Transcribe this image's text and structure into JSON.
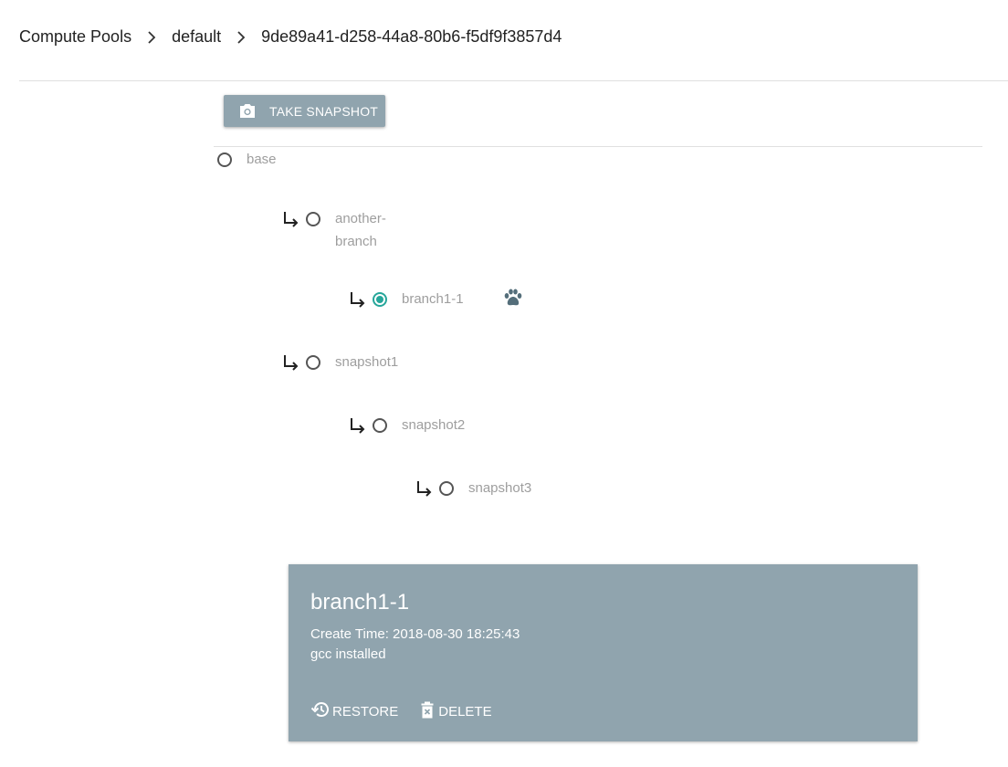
{
  "breadcrumb": {
    "items": [
      "Compute Pools",
      "default",
      "9de89a41-d258-44a8-80b6-f5df9f3857d4"
    ]
  },
  "toolbar": {
    "take_snapshot_label": "TAKE SNAPSHOT",
    "take_snapshot_icon": "camera-icon"
  },
  "tree": {
    "nodes": [
      {
        "label": "base",
        "selected": false
      },
      {
        "label_line1": "another-",
        "label_line2": "branch",
        "selected": false
      },
      {
        "label": "branch1-1",
        "selected": true,
        "badge_icon": "paw-icon"
      },
      {
        "label": "snapshot1",
        "selected": false
      },
      {
        "label": "snapshot2",
        "selected": false
      },
      {
        "label": "snapshot3",
        "selected": false
      }
    ]
  },
  "detail": {
    "title": "branch1-1",
    "create_time": "Create Time: 2018-08-30 18:25:43",
    "description": "gcc installed",
    "restore_label": "RESTORE",
    "delete_label": "DELETE"
  },
  "colors": {
    "accent": "#26a69a",
    "card_bg": "#90a4ae",
    "button_bg": "#90a4ae"
  }
}
